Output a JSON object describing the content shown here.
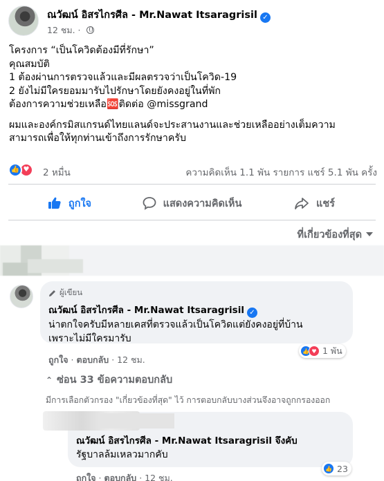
{
  "post": {
    "author": "ณวัฒน์ อิสรไกรศีล - Mr.Nawat Itsaragrisil",
    "time": "12 ชม.",
    "body_lines": [
      "โครงการ “เป็นโควิดต้องมีที่รักษา”",
      "คุณสมบัติ",
      "1 ต้องผ่านการตรวจแล้วและมีผลตรวจว่าเป็นโควิด-19",
      "2 ยังไม่มีใครยอมมารับไปรักษาโดยยังคงอยู่ในที่พัก",
      "ต้องการความช่วยเหลือ🆘ติดต่อ @missgrand"
    ],
    "body_lines_2": [
      "ผมและองค์กรมิสแกรนด์ไทยแลนด์จะประสานงานและช่วยเหลืออย่างเต็มความ",
      "สามารถเพื่อให้ทุกท่านเข้าถึงการรักษาครับ"
    ],
    "reaction_count": "2 หมื่น",
    "stats_right": "ความคิดเห็น 1.1 พัน รายการ  แชร์ 5.1 พัน ครั้ง"
  },
  "actions": {
    "like": "ถูกใจ",
    "comment": "แสดงความคิดเห็น",
    "share": "แชร์"
  },
  "sort_label": "ที่เกี่ยวข้องที่สุด",
  "comments": [
    {
      "badge": "ผู้เขียน",
      "name": "ณวัฒน์ อิสรไกรศีล - Mr.Nawat Itsaragrisil",
      "lines": [
        "น่าตกใจครับมีหลายเคสที่ตรวจแล้วเป็นโควิดแต่ยังคงอยู่ที่บ้าน",
        "เพราะไม่มีใครมารับ"
      ],
      "like": "ถูกใจ",
      "reply": "ตอบกลับ",
      "time": "12 ชม.",
      "reactions": "1 พัน"
    },
    {
      "name": "ณวัฒน์ อิสรไกรศีล - Mr.Nawat Itsaragrisil จึงคับ",
      "lines": [
        "รัฐบาลล้มเหลวมากคับ"
      ],
      "like": "ถูกใจ",
      "reply": "ตอบกลับ",
      "time": "12 ชม.",
      "reactions": "23"
    }
  ],
  "replies_label": "ซ่อน 33 ข้อความตอบกลับ",
  "filter_note": "มีการเลือกตัวกรอง \"เกี่ยวข้องที่สุด\" ไว้ การตอบกลับบางส่วนจึงอาจถูกกรองออก",
  "colors": {
    "accent": "#1877f2",
    "love": "#f33e58",
    "secondary_text": "#65676b",
    "bubble": "#f0f2f5"
  }
}
